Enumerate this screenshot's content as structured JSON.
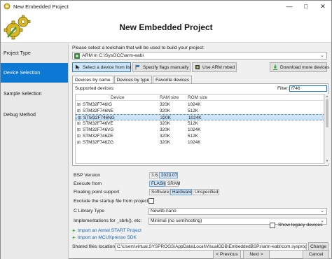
{
  "window": {
    "title": "New Embedded Project"
  },
  "header": {
    "title": "New Embedded Project"
  },
  "sidebar": {
    "items": [
      {
        "label": "Project Type",
        "active": false
      },
      {
        "label": "Device Selection",
        "active": true
      },
      {
        "label": "Sample Selection",
        "active": false
      },
      {
        "label": "Debug Method",
        "active": false
      }
    ]
  },
  "toolchain": {
    "prompt": "Please select a toolchain that will be used to build your project:",
    "selected": "ARM in C:\\SysGCC\\arm-eabi"
  },
  "toolbar": {
    "select_from_list": "Select a device from list",
    "specify_flags": "Specify flags manually",
    "use_arm_mbed": "Use ARM mbed",
    "download_more": "Download more devices"
  },
  "tabs": [
    "Devices by name",
    "Devices by type",
    "Favorite devices"
  ],
  "devices": {
    "supported_label": "Supported devices:",
    "filter_label": "Filter:",
    "filter_value": "f746",
    "columns": [
      "Device",
      "RAM size",
      "ROM size"
    ],
    "rows": [
      {
        "device": "STM32F746IG",
        "ram": "320K",
        "rom": "1024K",
        "selected": false
      },
      {
        "device": "STM32F746NE",
        "ram": "320K",
        "rom": "512K",
        "selected": false
      },
      {
        "device": "STM32F746NG",
        "ram": "320K",
        "rom": "1024K",
        "selected": true
      },
      {
        "device": "STM32F746VE",
        "ram": "320K",
        "rom": "512K",
        "selected": false
      },
      {
        "device": "STM32F746VG",
        "ram": "320K",
        "rom": "1024K",
        "selected": false
      },
      {
        "device": "STM32F746ZE",
        "ram": "320K",
        "rom": "512K",
        "selected": false
      },
      {
        "device": "STM32F746ZG",
        "ram": "320K",
        "rom": "1024K",
        "selected": false
      }
    ]
  },
  "bsp": {
    "label": "BSP Version",
    "versions": [
      "3.6",
      "2023.07"
    ],
    "selected": "2023.07"
  },
  "execute_from": {
    "label": "Execute from",
    "options": [
      "FLASH",
      "SRAM"
    ],
    "selected": "FLASH"
  },
  "fpu": {
    "label": "Floating point support",
    "options": [
      "Software",
      "Hardware",
      "Unspecified"
    ],
    "selected": "Hardware"
  },
  "exclude_startup": {
    "label": "Exclude the startup file from project",
    "checked": false
  },
  "c_library": {
    "label": "C Library Type",
    "value": "Newlib-nano"
  },
  "sbrk": {
    "label": "Implementations for _sbrk(), etc:",
    "value": "Minimal (no semihosting)"
  },
  "links": {
    "atmel": "Import an Atmel START Project",
    "mcuxpresso": "Import an MCUXpresso SDK"
  },
  "legacy": {
    "label": "Show legacy devices",
    "checked": false
  },
  "shared_files": {
    "label": "Shared files location:",
    "value": "C:\\Users\\virtual.SYSPROGS\\AppData\\Local\\VisualGDB\\EmbeddedBSPs\\arm-eabi\\com.sysprogs.a",
    "change_label": "Change"
  },
  "footer": {
    "previous": "< Previous",
    "next": "Next >",
    "cancel": "Cancel"
  },
  "colors": {
    "accent": "#0e78d5",
    "selection": "#cde3f7"
  }
}
